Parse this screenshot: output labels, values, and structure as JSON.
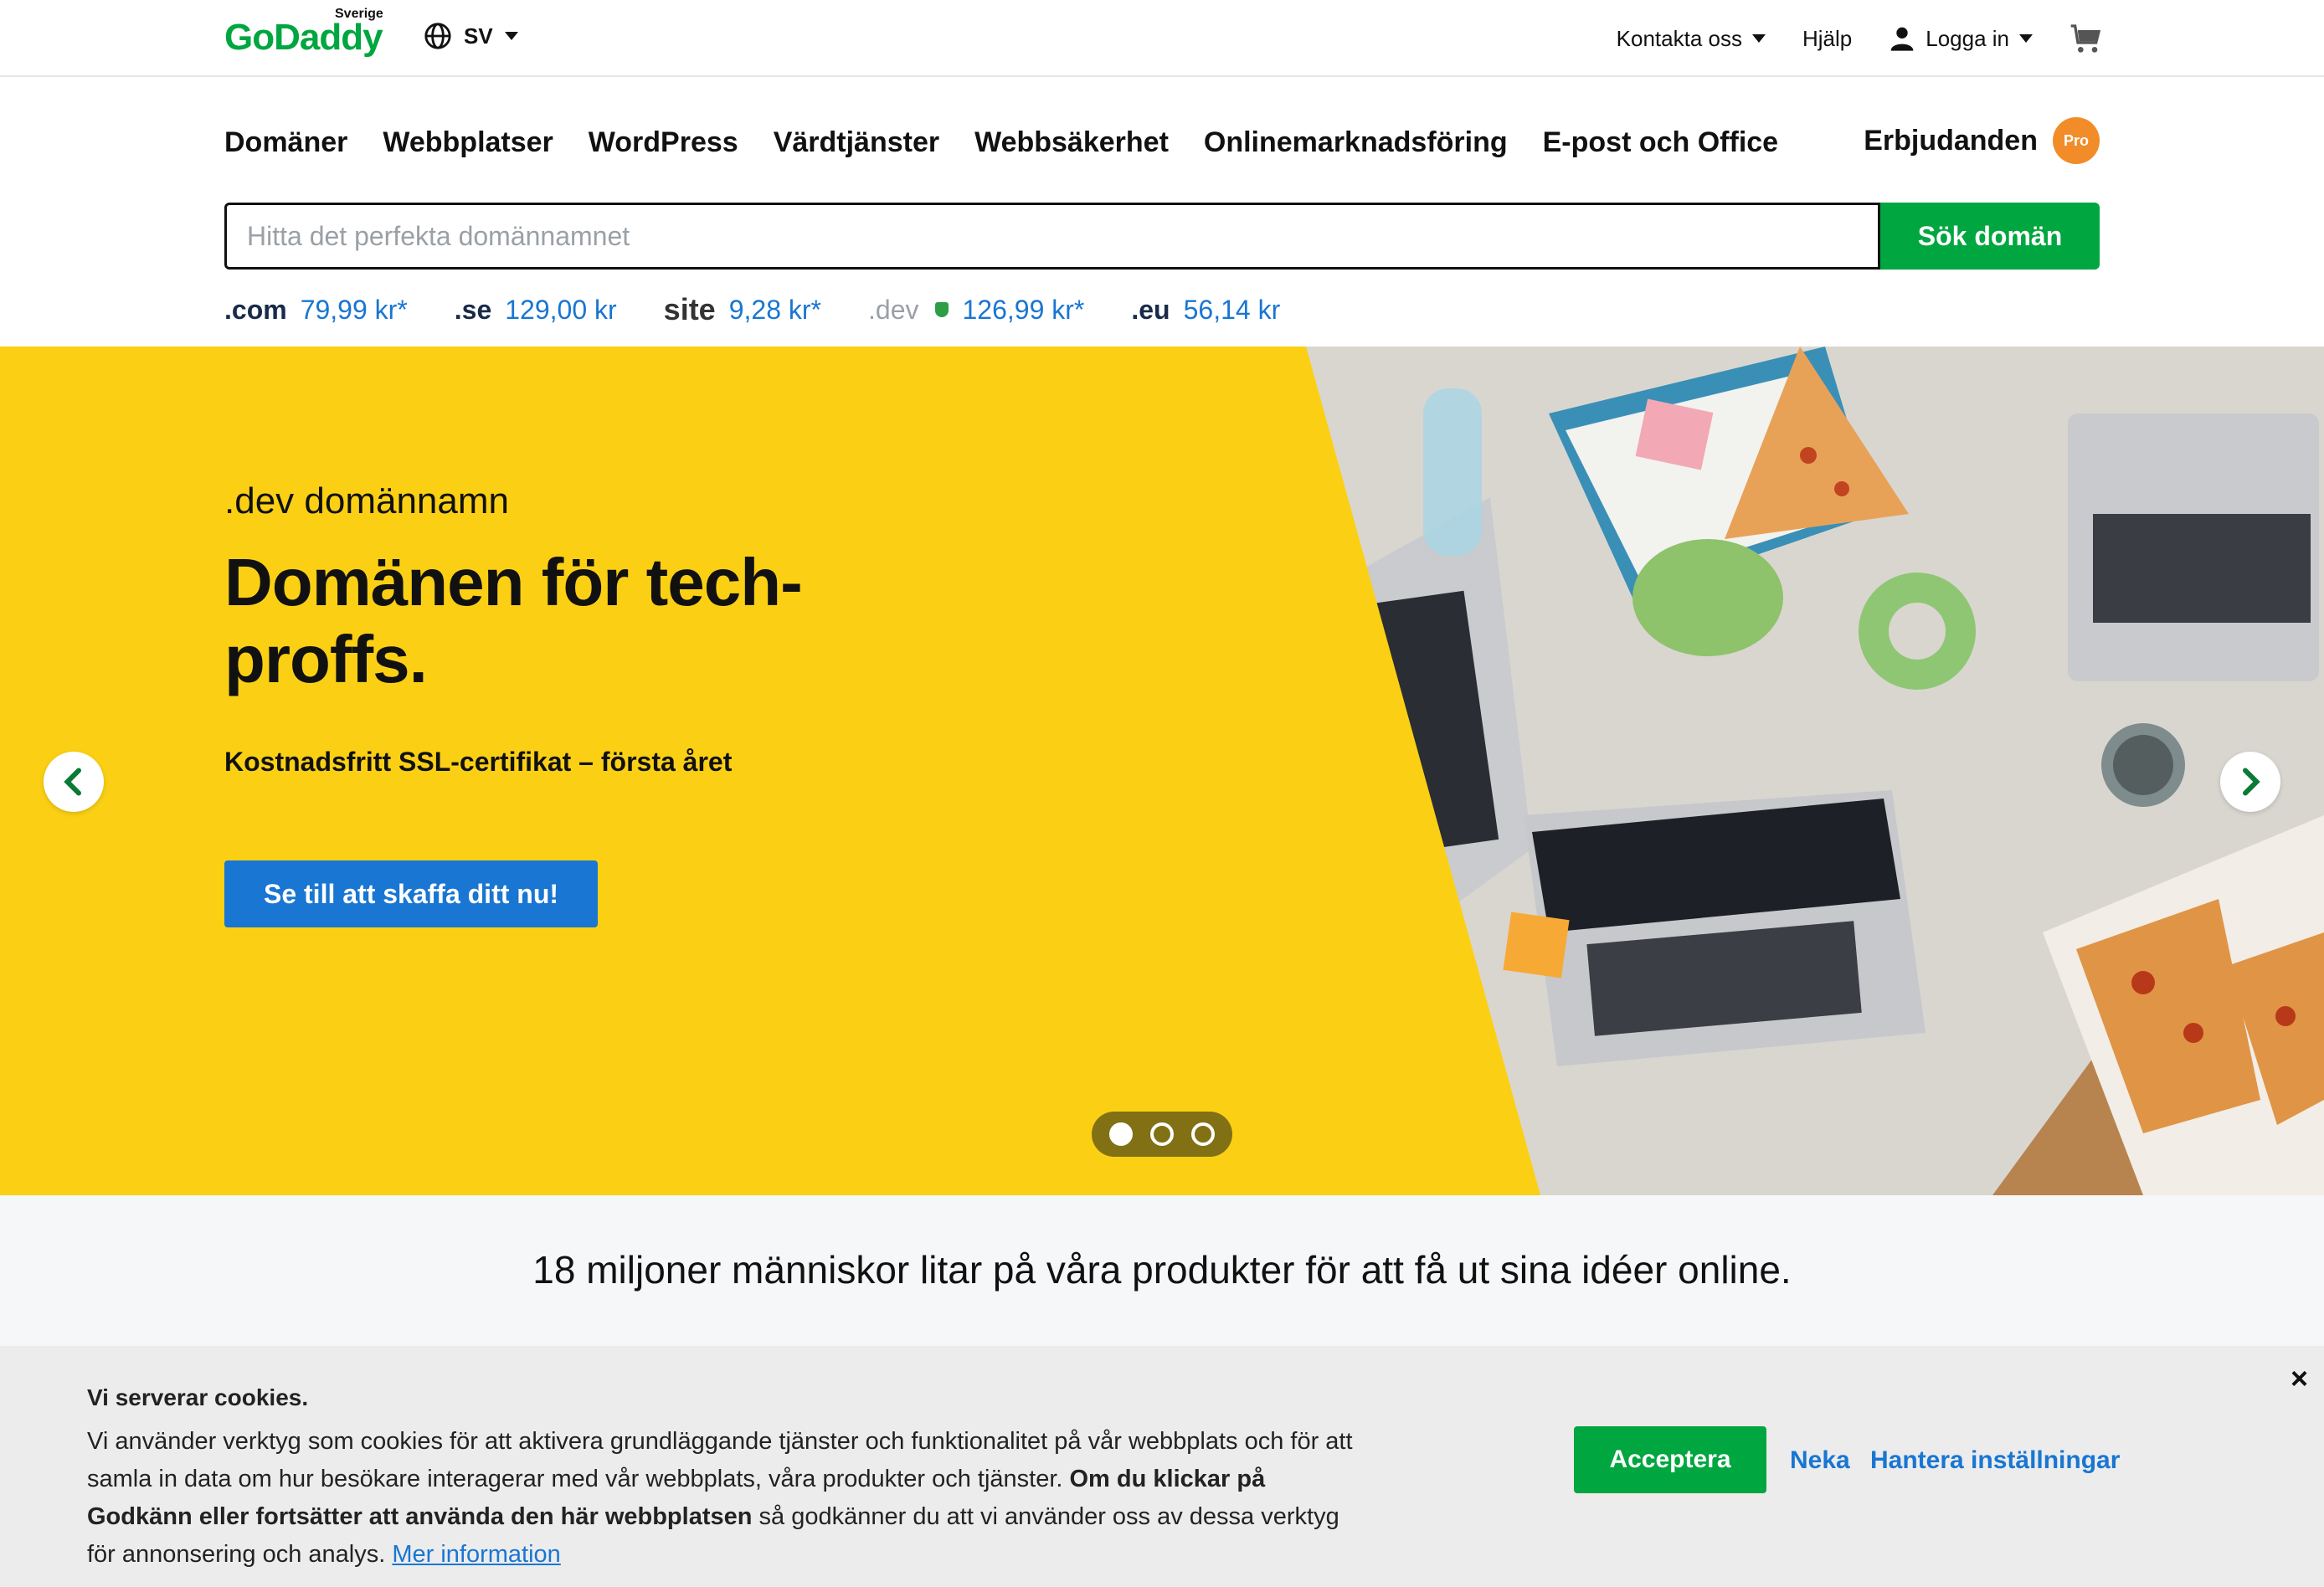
{
  "header": {
    "logo_text": "GoDaddy",
    "logo_country": "Sverige",
    "language": "SV",
    "contact_label": "Kontakta oss",
    "help_label": "Hjälp",
    "login_label": "Logga in"
  },
  "nav": {
    "items": [
      {
        "label": "Domäner"
      },
      {
        "label": "Webbplatser"
      },
      {
        "label": "WordPress"
      },
      {
        "label": "Värdtjänster"
      },
      {
        "label": "Webbsäkerhet"
      },
      {
        "label": "Onlinemarknadsföring"
      },
      {
        "label": "E-post och Office"
      }
    ],
    "deals_label": "Erbjudanden",
    "pro_badge": "Pro"
  },
  "search": {
    "placeholder": "Hitta det perfekta domännamnet",
    "value": "",
    "button_label": "Sök domän"
  },
  "tlds": [
    {
      "name": ".com",
      "price": "79,99 kr*"
    },
    {
      "name": ".se",
      "price": "129,00 kr"
    },
    {
      "name": "site",
      "price": "9,28 kr*"
    },
    {
      "name": ".dev",
      "price": "126,99 kr*"
    },
    {
      "name": ".eu",
      "price": "56,14 kr"
    }
  ],
  "hero": {
    "subtitle": ".dev domännamn",
    "title_line1": "Domänen för tech-",
    "title_line2": "proffs.",
    "description": "Kostnadsfritt SSL-certifikat – första året",
    "cta_label": "Se till att skaffa ditt nu!",
    "carousel_active_index": 0,
    "carousel_count": 3,
    "background_color": "#fbd014"
  },
  "trust": {
    "text": "18 miljoner människor litar på våra produkter för att få ut sina idéer online."
  },
  "cookie": {
    "title": "Vi serverar cookies.",
    "body_part1": "Vi använder verktyg som cookies för att aktivera grundläggande tjänster och funktionalitet på vår webbplats och för att samla in data om hur besökare interagerar med vår webbplats, våra produkter och tjänster. ",
    "body_bold": "Om du klickar på Godkänn eller fortsätter att använda den här webbplatsen",
    "body_part2": " så godkänner du att vi använder oss av dessa verktyg för annonsering och analys. ",
    "more_link": "Mer information",
    "accept_label": "Acceptera",
    "deny_label": "Neka",
    "manage_label": "Hantera inställningar",
    "close_label": "×"
  },
  "colors": {
    "brand_green": "#00a63f",
    "link_blue": "#1976d2",
    "hero_yellow": "#fbd014",
    "pro_orange": "#f28c28"
  }
}
